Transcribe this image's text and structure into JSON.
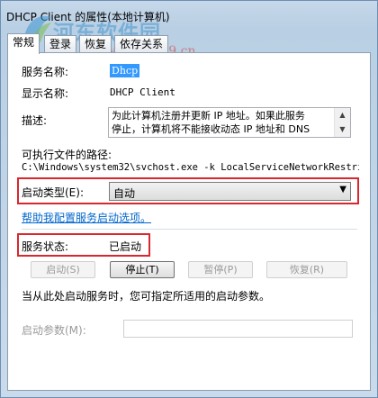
{
  "window": {
    "title": "DHCP Client 的属性(本地计算机)"
  },
  "watermark": {
    "text": "河东软件园",
    "url": "www.pc0359.cn"
  },
  "tabs": [
    {
      "label": "常规"
    },
    {
      "label": "登录"
    },
    {
      "label": "恢复"
    },
    {
      "label": "依存关系"
    }
  ],
  "general": {
    "service_name_label": "服务名称:",
    "service_name_value": "Dhcp",
    "display_name_label": "显示名称:",
    "display_name_value": "DHCP Client",
    "description_label": "描述:",
    "description_line1": "为此计算机注册并更新 IP 地址。如果此服务",
    "description_line2": "停止，计算机将不能接收动态 IP 地址和 DNS",
    "path_label": "可执行文件的路径:",
    "path_value": "C:\\Windows\\system32\\svchost.exe -k LocalServiceNetworkRestri",
    "startup_type_label": "启动类型(E):",
    "startup_type_value": "自动",
    "help_link": "帮助我配置服务启动选项。",
    "status_label": "服务状态:",
    "status_value": "已启动",
    "buttons": {
      "start": "启动(S)",
      "stop": "停止(T)",
      "pause": "暂停(P)",
      "resume": "恢复(R)"
    },
    "hint": "当从此处启动服务时，您可指定所适用的启动参数。",
    "start_params_label": "启动参数(M):",
    "start_params_value": ""
  },
  "colors": {
    "highlight": "#d9272e",
    "selection": "#3399ff",
    "link": "#0066cc"
  }
}
